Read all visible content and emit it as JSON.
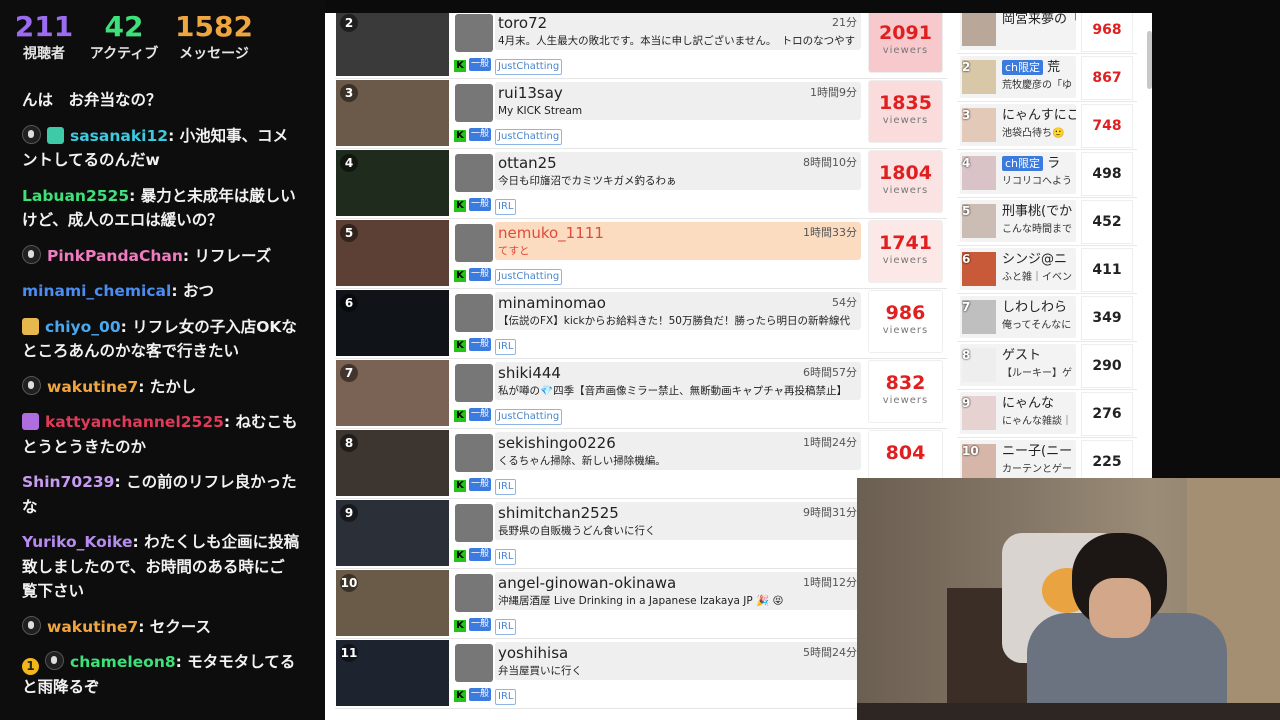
{
  "chat": {
    "stats": [
      {
        "value": "211",
        "label": "視聴者",
        "color": "#9b6cf0"
      },
      {
        "value": "42",
        "label": "アクティブ",
        "color": "#3ee07a"
      },
      {
        "value": "1582",
        "label": "メッセージ",
        "color": "#f0a640"
      }
    ],
    "messages": [
      {
        "user": "",
        "text": "んは　お弁当なの？",
        "color": "#ffffff",
        "badges": []
      },
      {
        "user": "sasanaki12",
        "text": ": 小池知事、コメントしてるのんだw",
        "color": "#3ec9e0",
        "badges": [
          "icon-pengu",
          "icon-gift-teal"
        ]
      },
      {
        "user": "Labuan2525",
        "text": ": 暴力と未成年は厳しいけど、成人のエロは緩いの？",
        "color": "#3ee07a",
        "badges": []
      },
      {
        "user": "PinkPandaChan",
        "text": ": リフレーズ",
        "color": "#f07cc0",
        "badges": [
          "icon-pengu"
        ]
      },
      {
        "user": "minami_chemical",
        "text": ": おつ",
        "color": "#4a8cf0",
        "badges": []
      },
      {
        "user": "chiyo_00",
        "text": ": リフレ女の子入店OKなところあんのかな客で行きたい",
        "color": "#4aa8f0",
        "badges": [
          "icon-gift-gold"
        ]
      },
      {
        "user": "wakutine7",
        "text": ": たかし",
        "color": "#f0a640",
        "badges": [
          "icon-pengu"
        ]
      },
      {
        "user": "kattyanchannel2525",
        "text": ": ねむこもとうとうきたのか",
        "color": "#e03a5a",
        "badges": [
          "icon-gift-purple"
        ]
      },
      {
        "user": "Shin70239",
        "text": ": この前のリフレ良かったな",
        "color": "#c79cf0",
        "badges": []
      },
      {
        "user": "Yuriko_Koike",
        "text": ": わたくしも企画に投稿致しましたので、お時間のある時にご覧下さい",
        "color": "#b78cf0",
        "badges": []
      },
      {
        "user": "wakutine7",
        "text": ": セクース",
        "color": "#f0a640",
        "badges": [
          "icon-pengu"
        ]
      },
      {
        "user": "chameleon8",
        "text": ": モタモタしてると雨降るぞ",
        "color": "#3ee07a",
        "badges": [
          "icon-one",
          "icon-pengu"
        ],
        "badge_text": "1"
      }
    ]
  },
  "streams": [
    {
      "rank": "2",
      "name": "toro72",
      "duration": "21分",
      "title": "4月末。人生最大の敗北です。本当に申し訳ございません。　トロのなつやす",
      "category": "JustChatting",
      "viewers": "2091",
      "viewers_label": "viewers",
      "highlight": false,
      "bg": "#f7c9cc"
    },
    {
      "rank": "3",
      "name": "rui13say",
      "duration": "1時間9分",
      "title": "My KICK Stream",
      "category": "JustChatting",
      "viewers": "1835",
      "viewers_label": "viewers",
      "highlight": false,
      "bg": "#fbdcdc"
    },
    {
      "rank": "4",
      "name": "ottan25",
      "duration": "8時間10分",
      "title": "今日も印旛沼でカミツキガメ釣るわぁ",
      "category": "IRL",
      "viewers": "1804",
      "viewers_label": "viewers",
      "highlight": false,
      "bg": "#fbe3e3"
    },
    {
      "rank": "5",
      "name": "nemuko_1111",
      "duration": "1時間33分",
      "title": "てすと",
      "category": "JustChatting",
      "viewers": "1741",
      "viewers_label": "viewers",
      "highlight": true,
      "bg": "#fde8e8"
    },
    {
      "rank": "6",
      "name": "minaminomao",
      "duration": "54分",
      "title": "【伝説のFX】kickからお給料きた！50万勝負だ！勝ったら明日の新幹線代",
      "category": "IRL",
      "viewers": "986",
      "viewers_label": "viewers",
      "highlight": false,
      "bg": "#ffffff"
    },
    {
      "rank": "7",
      "name": "shiki444",
      "duration": "6時間57分",
      "title": "私が噂の💎四季【音声画像ミラー禁止、無断動画キャプチャ再投稿禁止】",
      "category": "JustChatting",
      "viewers": "832",
      "viewers_label": "viewers",
      "highlight": false,
      "bg": "#ffffff"
    },
    {
      "rank": "8",
      "name": "sekishingo0226",
      "duration": "1時間24分",
      "title": "くるちゃん掃除、新しい掃除機編。",
      "category": "IRL",
      "viewers": "804",
      "viewers_label": "",
      "highlight": false,
      "bg": "#ffffff"
    },
    {
      "rank": "9",
      "name": "shimitchan2525",
      "duration": "9時間31分",
      "title": "長野県の自販機うどん食いに行く",
      "category": "IRL",
      "viewers": "",
      "viewers_label": "",
      "highlight": false,
      "bg": "#ffffff"
    },
    {
      "rank": "10",
      "name": "angel-ginowan-okinawa",
      "duration": "1時間12分",
      "title": "沖縄居酒屋 Live Drinking in a Japanese Izakaya JP 🎉 😝",
      "category": "IRL",
      "viewers": "",
      "viewers_label": "",
      "highlight": false,
      "bg": "#ffffff"
    },
    {
      "rank": "11",
      "name": "yoshihisa",
      "duration": "5時間24分",
      "title": "弁当屋買いに行く",
      "category": "IRL",
      "viewers": "",
      "viewers_label": "",
      "highlight": false,
      "bg": "#ffffff"
    }
  ],
  "stream_badges": {
    "platform": "K",
    "genre": "一般"
  },
  "ranking": [
    {
      "rank": "",
      "name": "岡宮来夢の「く",
      "sub": "",
      "ch": false,
      "count": "968",
      "red": true
    },
    {
      "rank": "2",
      "name": "荒",
      "sub": "荒牧慶彦の「ゆ",
      "ch": true,
      "ch_label": "ch限定",
      "count": "867",
      "red": true
    },
    {
      "rank": "3",
      "name": "にゃんすにこ",
      "sub": "池袋凸待ち🙂",
      "ch": false,
      "count": "748",
      "red": true
    },
    {
      "rank": "4",
      "name": "ラ",
      "sub": "リコリコへよう",
      "ch": true,
      "ch_label": "ch限定",
      "count": "498",
      "red": false
    },
    {
      "rank": "5",
      "name": "刑事桃(でか",
      "sub": "こんな時間まで",
      "ch": false,
      "count": "452",
      "red": false
    },
    {
      "rank": "6",
      "name": "シンジ@ニ",
      "sub": "ふと雑｜イベン",
      "ch": false,
      "count": "411",
      "red": false
    },
    {
      "rank": "7",
      "name": "しわしわら",
      "sub": "俺ってそんなに",
      "ch": false,
      "count": "349",
      "red": false
    },
    {
      "rank": "8",
      "name": "ゲスト",
      "sub": "【ルーキー】ゲ",
      "ch": false,
      "count": "290",
      "red": false
    },
    {
      "rank": "9",
      "name": "にゃんな",
      "sub": "にゃんな雑談｜",
      "ch": false,
      "count": "276",
      "red": false
    },
    {
      "rank": "10",
      "name": "ニー子(ニー",
      "sub": "カーテンとゲー",
      "ch": false,
      "count": "225",
      "red": false
    }
  ]
}
